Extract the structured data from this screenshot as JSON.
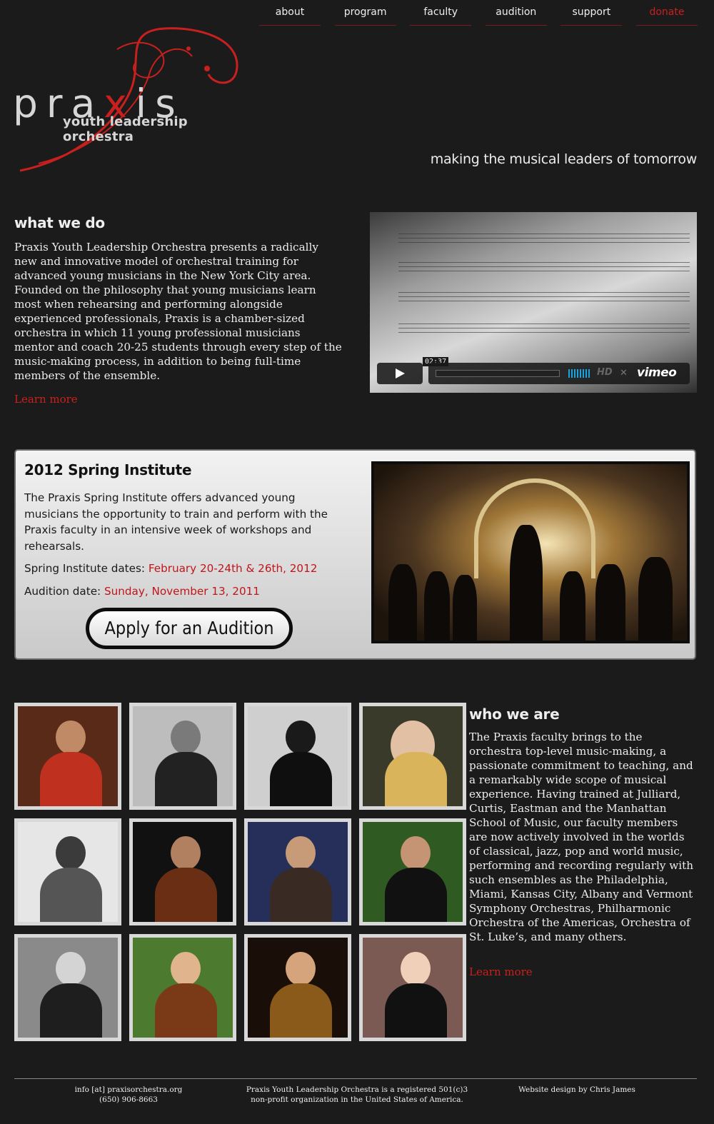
{
  "nav": {
    "items": [
      {
        "label": "about"
      },
      {
        "label": "program"
      },
      {
        "label": "faculty"
      },
      {
        "label": "audition"
      },
      {
        "label": "support"
      },
      {
        "label": "donate"
      }
    ]
  },
  "logo": {
    "word_a": "pra",
    "word_x": "x",
    "word_b": "is",
    "subtitle": "youth leadership orchestra"
  },
  "tagline": "making the musical leaders of tomorrow",
  "what_we_do": {
    "title": "what we do",
    "body": "Praxis Youth Leadership Orchestra presents a radically new and innovative model of orchestral training for advanced young musicians in the New York City area. Founded on the philosophy that young musicians learn most when rehearsing and performing alongside experienced professionals, Praxis is a chamber-sized orchestra in which 11 young professional musicians mentor and coach 20-25 students through every step of the music-making process, in addition to being full-time members of the ensemble.",
    "learn_more": "Learn more"
  },
  "video": {
    "duration": "02:37",
    "hd_label": "HD",
    "brand": "vimeo"
  },
  "institute": {
    "title": "2012 Spring Institute",
    "body": "The Praxis Spring Institute offers advanced young musicians the opportunity to train and perform with the Praxis faculty in an intensive week of workshops and rehearsals.",
    "dates_label": "Spring Institute dates:",
    "dates_value": "February 20-24th & 26th, 2012",
    "audition_label": "Audition date:",
    "audition_value": "Sunday, November 13, 2011",
    "apply_button": "Apply for an Audition"
  },
  "who_we_are": {
    "title": "who we are",
    "body": "The Praxis faculty brings to the orchestra top-level music-making, a passionate commitment to teaching, and a remarkably wide scope of musical experience. Having trained at Julliard, Curtis, Eastman and the Manhattan School of Music, our faculty members are now actively involved in the worlds of classical, jazz, pop and world music, performing and recording regularly with such ensembles as the Philadelphia, Miami, Kansas City, Albany and Vermont Symphony Orchestras, Philharmonic Orchestra of the Americas, Orchestra of St. Luke’s, and many others.",
    "learn_more": "Learn more"
  },
  "footer": {
    "contact_email": "info [at] praxisorchestra.org",
    "contact_phone": "(650) 906-8663",
    "nonprofit_line1": "Praxis Youth Leadership Orchestra is a registered 501(c)3",
    "nonprofit_line2": "non-profit organization in the United States of America.",
    "credit": "Website design by Chris James"
  },
  "colors": {
    "accent_red": "#c8201e",
    "background": "#1b1b1b",
    "panel_light": "#e6e6e6"
  }
}
